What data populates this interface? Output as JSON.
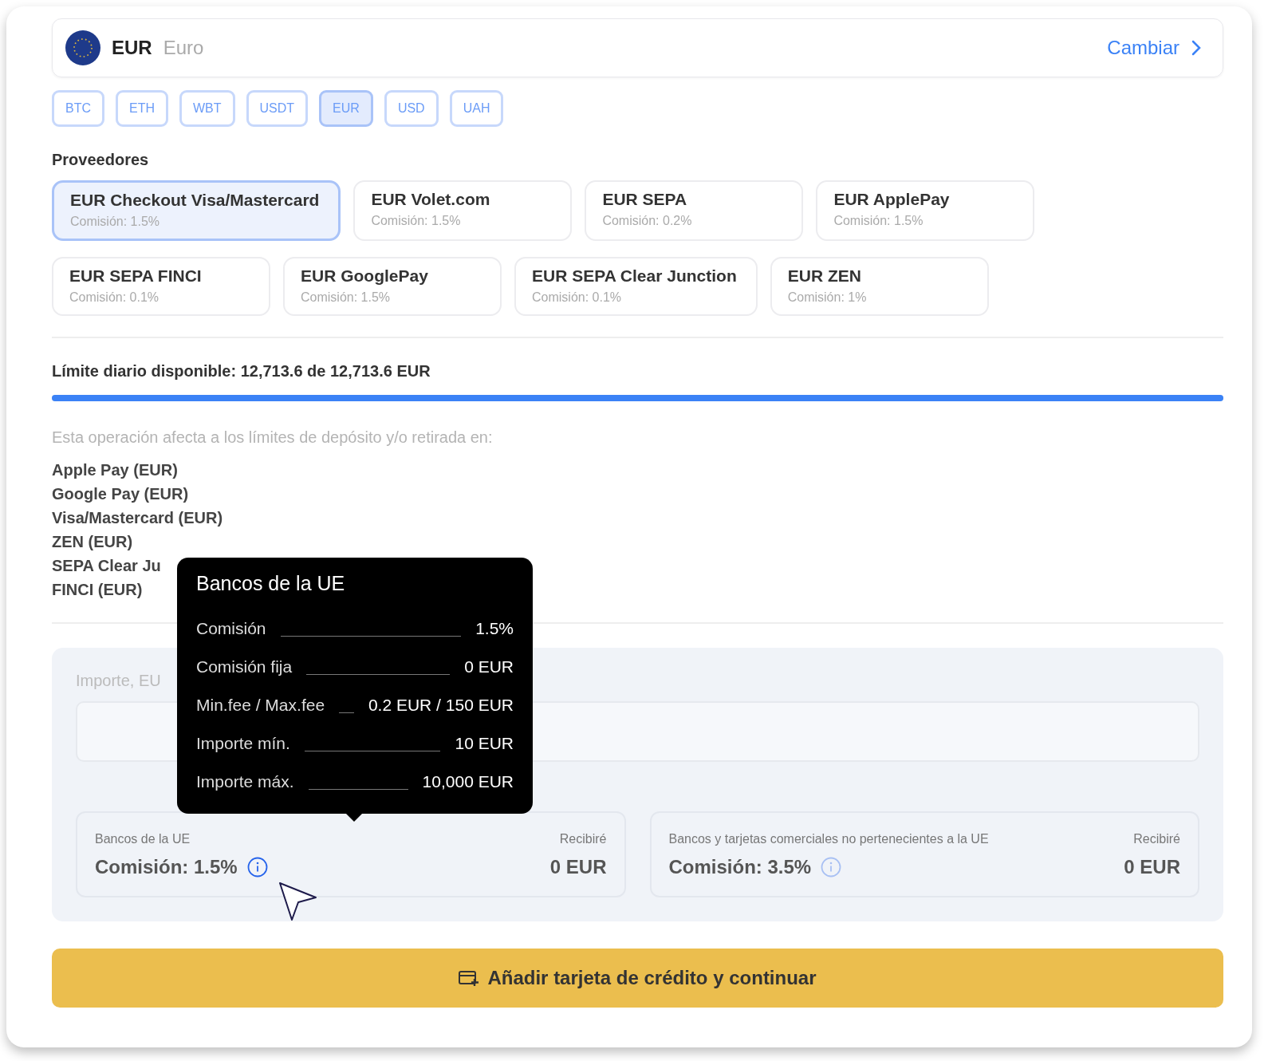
{
  "currency": {
    "code": "EUR",
    "name": "Euro",
    "change_link": "Cambiar"
  },
  "chips": [
    {
      "label": "BTC",
      "selected": false
    },
    {
      "label": "ETH",
      "selected": false
    },
    {
      "label": "WBT",
      "selected": false
    },
    {
      "label": "USDT",
      "selected": false
    },
    {
      "label": "EUR",
      "selected": true
    },
    {
      "label": "USD",
      "selected": false
    },
    {
      "label": "UAH",
      "selected": false
    }
  ],
  "providers_title": "Proveedores",
  "providers": [
    [
      {
        "name": "EUR Checkout Visa/Mastercard",
        "fee": "Comisión: 1.5%",
        "selected": true
      },
      {
        "name": "EUR Volet.com",
        "fee": "Comisión: 1.5%",
        "selected": false
      },
      {
        "name": "EUR SEPA",
        "fee": "Comisión: 0.2%",
        "selected": false
      },
      {
        "name": "EUR ApplePay",
        "fee": "Comisión: 1.5%",
        "selected": false
      }
    ],
    [
      {
        "name": "EUR SEPA FINCI",
        "fee": "Comisión: 0.1%",
        "selected": false
      },
      {
        "name": "EUR GooglePay",
        "fee": "Comisión: 1.5%",
        "selected": false
      },
      {
        "name": "EUR SEPA Clear Junction",
        "fee": "Comisión: 0.1%",
        "selected": false
      },
      {
        "name": "EUR ZEN",
        "fee": "Comisión: 1%",
        "selected": false
      }
    ]
  ],
  "daily_limit": {
    "label": "Límite diario disponible: 12,713.6 de 12,713.6 EUR",
    "level": 1
  },
  "note": "Esta operación afecta a los límites de depósito y/o retirada en:",
  "affected": [
    "Apple Pay (EUR)",
    "Google Pay (EUR)",
    "Visa/Mastercard (EUR)",
    "ZEN (EUR)",
    "SEPA Clear Ju",
    "FINCI (EUR)"
  ],
  "amount": {
    "label": "Importe, EU"
  },
  "results": [
    {
      "title": "Bancos de la UE",
      "fee": "Comisión: 1.5%",
      "receive_label": "Recibiré",
      "receive": "0 EUR",
      "active": true
    },
    {
      "title": "Bancos y tarjetas comerciales no pertenecientes a la UE",
      "fee": "Comisión: 3.5%",
      "receive_label": "Recibiré",
      "receive": "0 EUR",
      "active": false
    }
  ],
  "tooltip": {
    "title": "Bancos de la UE",
    "rows": [
      {
        "label": "Comisión",
        "value": "1.5%"
      },
      {
        "label": "Comisión fija",
        "value": "0 EUR"
      },
      {
        "label": "Min.fee / Max.fee",
        "value": "0.2 EUR / 150 EUR"
      },
      {
        "label": "Importe mín.",
        "value": "10 EUR"
      },
      {
        "label": "Importe máx.",
        "value": "10,000 EUR"
      }
    ]
  },
  "submit": "Añadir tarjeta de crédito y continuar"
}
